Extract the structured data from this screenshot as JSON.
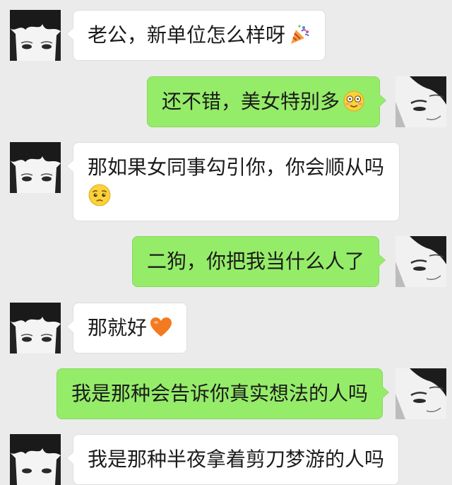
{
  "messages": [
    {
      "side": "received",
      "text": "老公，新单位怎么样呀",
      "emoji": "party-popper-icon"
    },
    {
      "side": "sent",
      "text": "还不错，美女特别多",
      "emoji": "smiling-face-icon"
    },
    {
      "side": "received",
      "text": "那如果女同事勾引你，你会顺从吗",
      "emoji": "pleading-face-icon"
    },
    {
      "side": "sent",
      "text": "二狗，你把我当什么人了"
    },
    {
      "side": "received",
      "text": "那就好",
      "emoji": "orange-heart-icon"
    },
    {
      "side": "sent",
      "text": "我是那种会告诉你真实想法的人吗"
    },
    {
      "side": "received",
      "text": "我是那种半夜拿着剪刀梦游的人吗"
    }
  ],
  "colors": {
    "background": "#ebebeb",
    "received_bubble": "#ffffff",
    "sent_bubble": "#95ec69"
  }
}
